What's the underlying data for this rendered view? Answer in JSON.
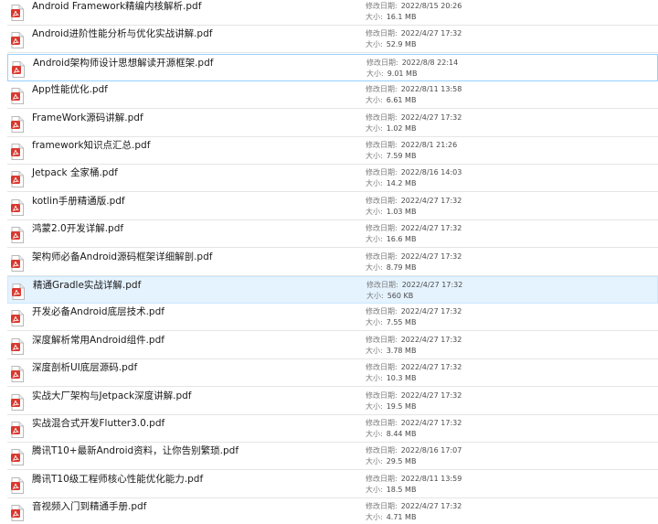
{
  "labels": {
    "modified": "修改日期:",
    "size": "大小:"
  },
  "files": [
    {
      "name": "Android Framework精编内核解析.pdf",
      "modified": "2022/8/15 20:26",
      "size": "16.1 MB"
    },
    {
      "name": "Android进阶性能分析与优化实战讲解.pdf",
      "modified": "2022/4/27 17:32",
      "size": "52.9 MB"
    },
    {
      "name": "Android架构师设计思想解读开源框架.pdf",
      "modified": "2022/8/8 22:14",
      "size": "9.01 MB"
    },
    {
      "name": "App性能优化.pdf",
      "modified": "2022/8/11 13:58",
      "size": "6.61 MB"
    },
    {
      "name": "FrameWork源码讲解.pdf",
      "modified": "2022/4/27 17:32",
      "size": "1.02 MB"
    },
    {
      "name": "framework知识点汇总.pdf",
      "modified": "2022/8/1 21:26",
      "size": "7.59 MB"
    },
    {
      "name": "Jetpack 全家桶.pdf",
      "modified": "2022/8/16 14:03",
      "size": "14.2 MB"
    },
    {
      "name": "kotlin手册精通版.pdf",
      "modified": "2022/4/27 17:32",
      "size": "1.03 MB"
    },
    {
      "name": "鸿蒙2.0开发详解.pdf",
      "modified": "2022/4/27 17:32",
      "size": "16.6 MB"
    },
    {
      "name": "架构师必备Android源码框架详细解剖.pdf",
      "modified": "2022/4/27 17:32",
      "size": "8.79 MB"
    },
    {
      "name": "精通Gradle实战详解.pdf",
      "modified": "2022/4/27 17:32",
      "size": "560 KB"
    },
    {
      "name": "开发必备Android底层技术.pdf",
      "modified": "2022/4/27 17:32",
      "size": "7.55 MB"
    },
    {
      "name": "深度解析常用Android组件.pdf",
      "modified": "2022/4/27 17:32",
      "size": "3.78 MB"
    },
    {
      "name": "深度剖析UI底层源码.pdf",
      "modified": "2022/4/27 17:32",
      "size": "10.3 MB"
    },
    {
      "name": "实战大厂架构与Jetpack深度讲解.pdf",
      "modified": "2022/4/27 17:32",
      "size": "19.5 MB"
    },
    {
      "name": "实战混合式开发Flutter3.0.pdf",
      "modified": "2022/4/27 17:32",
      "size": "8.44 MB"
    },
    {
      "name": "腾讯T10+最新Android资料，让你告别繁琐.pdf",
      "modified": "2022/8/16 17:07",
      "size": "29.5 MB"
    },
    {
      "name": "腾讯T10级工程师核心性能优化能力.pdf",
      "modified": "2022/8/11 13:59",
      "size": "18.5 MB"
    },
    {
      "name": "音视频入门到精通手册.pdf",
      "modified": "2022/4/27 17:32",
      "size": "4.71 MB"
    }
  ],
  "selected_index": 10,
  "focused_index": 2,
  "colors": {
    "pdf_red": "#d9382f",
    "selection_bg": "#e5f3ff",
    "selection_border": "#cce8ff"
  }
}
